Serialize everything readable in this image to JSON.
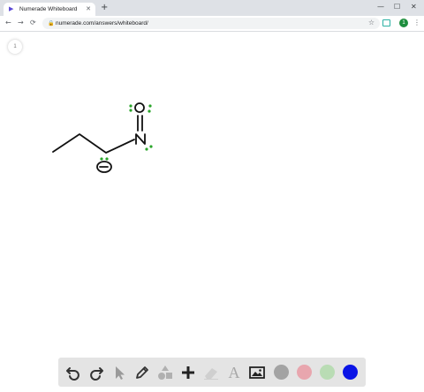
{
  "browser": {
    "tab": {
      "title": "Numerade Whiteboard",
      "favicon": "play-icon",
      "close_label": "✕"
    },
    "new_tab_label": "+",
    "window_controls": {
      "minimize": "—",
      "maximize": "☐",
      "close": "✕"
    },
    "nav": {
      "back": "←",
      "forward": "→",
      "reload": "⟳"
    },
    "address": {
      "lock": "🔒",
      "url": "numerade.com/answers/whiteboard/"
    },
    "profile_initial": "1"
  },
  "whiteboard": {
    "page_number": "1",
    "drawing": {
      "atoms": {
        "oxygen_top": "O",
        "nitrogen": "N"
      },
      "ink_color": "#111111",
      "lone_pair_color": "#2aa52a"
    },
    "toolbar": {
      "tools": [
        "undo-icon",
        "redo-icon",
        "pointer-icon",
        "pen-icon",
        "shapes-icon",
        "plus-icon",
        "eraser-icon",
        "text-icon",
        "image-icon"
      ],
      "text_tool_label": "A",
      "colors": [
        "#a3a3a3",
        "#e8a6ae",
        "#b9dcb4",
        "#0a14e6"
      ],
      "selected_color": "#0a14e6"
    }
  }
}
